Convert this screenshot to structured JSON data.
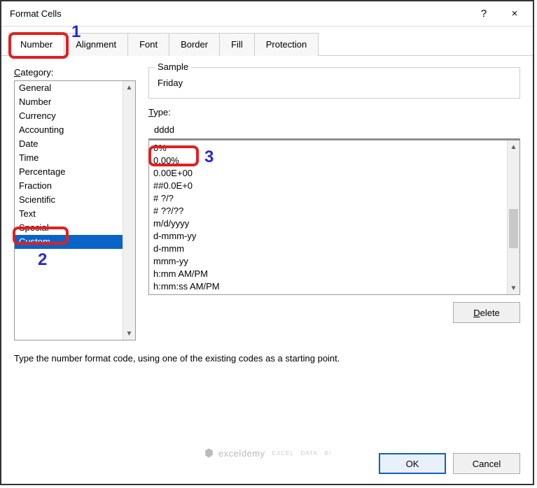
{
  "title": "Format Cells",
  "help_btn": "?",
  "close_btn": "×",
  "tabs": [
    "Number",
    "Alignment",
    "Font",
    "Border",
    "Fill",
    "Protection"
  ],
  "active_tab_index": 0,
  "annotations": {
    "n1": "1",
    "n2": "2",
    "n3": "3"
  },
  "category_label": "Category:",
  "categories": [
    "General",
    "Number",
    "Currency",
    "Accounting",
    "Date",
    "Time",
    "Percentage",
    "Fraction",
    "Scientific",
    "Text",
    "Special",
    "Custom"
  ],
  "selected_category_index": 11,
  "sample_label": "Sample",
  "sample_value": "Friday",
  "type_label": "Type:",
  "type_value": "dddd",
  "type_list": [
    "0%",
    "0.00%",
    "0.00E+00",
    "##0.0E+0",
    "# ?/?",
    "# ??/??",
    "m/d/yyyy",
    "d-mmm-yy",
    "d-mmm",
    "mmm-yy",
    "h:mm AM/PM",
    "h:mm:ss AM/PM"
  ],
  "delete_label": "Delete",
  "hint": "Type the number format code, using one of the existing codes as a starting point.",
  "ok_label": "OK",
  "cancel_label": "Cancel",
  "watermark": {
    "name": "exceldemy",
    "sub": "EXCEL · DATA · BI"
  }
}
